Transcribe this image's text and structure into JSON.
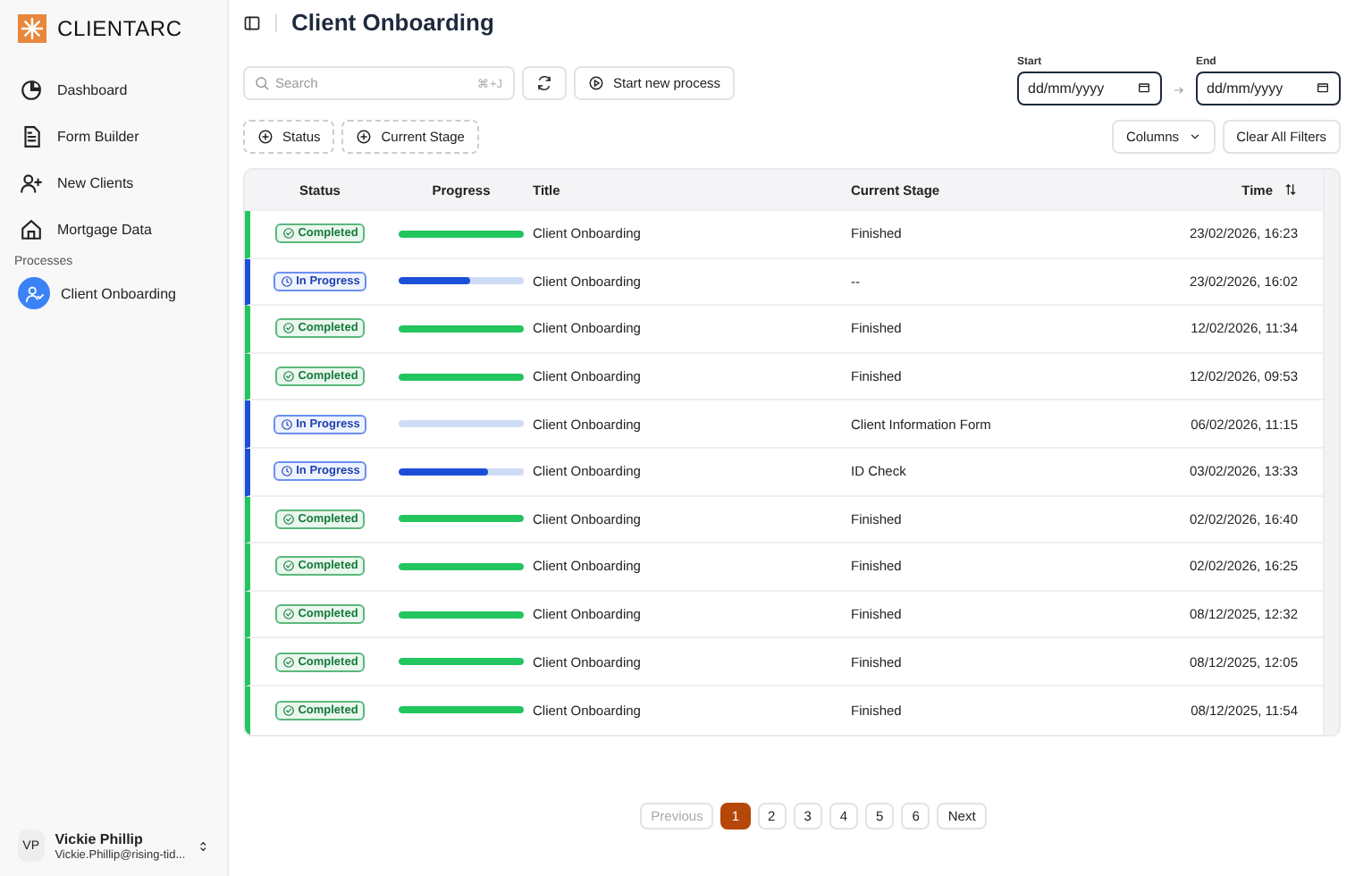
{
  "brand": {
    "name": "CLIENTARC"
  },
  "sidebar": {
    "items": [
      {
        "label": "Dashboard",
        "selected": false
      },
      {
        "label": "Form Builder",
        "selected": false
      },
      {
        "label": "New Clients",
        "selected": false
      },
      {
        "label": "Mortgage Data",
        "selected": false
      }
    ],
    "section": "Processes",
    "processes": [
      {
        "label": "Client Onboarding",
        "selected": true
      }
    ],
    "user": {
      "initials": "VP",
      "name": "Vickie Phillip",
      "email": "Vickie.Phillip@rising-tid..."
    }
  },
  "page": {
    "title": "Client Onboarding"
  },
  "toolbar": {
    "search": {
      "placeholder": "Search",
      "shortcut": "⌘+J"
    },
    "start_button": "Start new process",
    "filters": [
      "Status",
      "Current Stage"
    ],
    "date_range": {
      "start_label": "Start",
      "end_label": "End",
      "start_placeholder": "dd/mm/yyyy",
      "end_placeholder": "dd/mm/yyyy"
    },
    "columns_button": "Columns",
    "clear_button": "Clear All Filters"
  },
  "table": {
    "columns": [
      "Status",
      "Progress",
      "Title",
      "Current Stage",
      "Time"
    ],
    "rows": [
      {
        "status": "Completed",
        "kind": "completed",
        "level": 1,
        "title": "Client Onboarding",
        "stage": "Finished",
        "time": "23/02/2026, 16:23"
      },
      {
        "status": "In Progress",
        "kind": "in_progress",
        "level": 0.57,
        "title": "Client Onboarding",
        "stage": "--",
        "time": "23/02/2026, 16:02"
      },
      {
        "status": "Completed",
        "kind": "completed",
        "level": 1,
        "title": "Client Onboarding",
        "stage": "Finished",
        "time": "12/02/2026, 11:34"
      },
      {
        "status": "Completed",
        "kind": "completed",
        "level": 1,
        "title": "Client Onboarding",
        "stage": "Finished",
        "time": "12/02/2026, 09:53"
      },
      {
        "status": "In Progress",
        "kind": "in_progress",
        "level": 0,
        "title": "Client Onboarding",
        "stage": "Client Information Form",
        "time": "06/02/2026, 11:15"
      },
      {
        "status": "In Progress",
        "kind": "in_progress",
        "level": 0.71,
        "title": "Client Onboarding",
        "stage": "ID Check",
        "time": "03/02/2026, 13:33"
      },
      {
        "status": "Completed",
        "kind": "completed",
        "level": 1,
        "title": "Client Onboarding",
        "stage": "Finished",
        "time": "02/02/2026, 16:40"
      },
      {
        "status": "Completed",
        "kind": "completed",
        "level": 1,
        "title": "Client Onboarding",
        "stage": "Finished",
        "time": "02/02/2026, 16:25"
      },
      {
        "status": "Completed",
        "kind": "completed",
        "level": 1,
        "title": "Client Onboarding",
        "stage": "Finished",
        "time": "08/12/2025, 12:32"
      },
      {
        "status": "Completed",
        "kind": "completed",
        "level": 1,
        "title": "Client Onboarding",
        "stage": "Finished",
        "time": "08/12/2025, 12:05"
      },
      {
        "status": "Completed",
        "kind": "completed",
        "level": 1,
        "title": "Client Onboarding",
        "stage": "Finished",
        "time": "08/12/2025, 11:54"
      }
    ]
  },
  "pagination": {
    "previous": {
      "label": "Previous",
      "disabled": true
    },
    "pages": [
      {
        "label": "1",
        "selected": true
      },
      {
        "label": "2",
        "selected": false
      },
      {
        "label": "3",
        "selected": false
      },
      {
        "label": "4",
        "selected": false
      },
      {
        "label": "5",
        "selected": false
      },
      {
        "label": "6",
        "selected": false
      }
    ],
    "next": {
      "label": "Next",
      "disabled": false
    }
  }
}
